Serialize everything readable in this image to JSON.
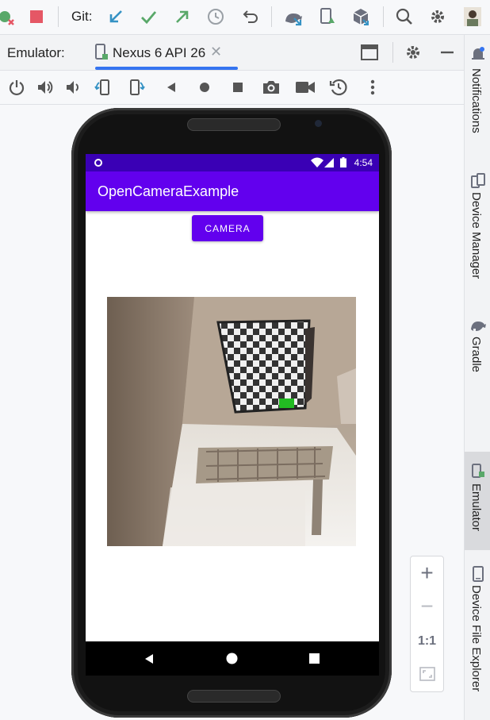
{
  "toolbar": {
    "git_label": "Git:",
    "icons": [
      "debug-stop-icon",
      "stop-icon",
      "update-project-icon",
      "commit-icon",
      "push-icon",
      "history-icon",
      "rollback-icon",
      "device-manager-icon",
      "app-inspection-icon",
      "sdk-icon",
      "search-icon",
      "settings-icon",
      "avatar-icon"
    ]
  },
  "emulator_header": {
    "label": "Emulator:",
    "tab_name": "Nexus 6 API 26",
    "tab_close": "✕"
  },
  "right_sidebar": {
    "items": [
      {
        "label": "Notifications",
        "icon": "bell-icon"
      },
      {
        "label": "Device Manager",
        "icon": "device-manager-icon"
      },
      {
        "label": "Gradle",
        "icon": "elephant-icon"
      },
      {
        "label": "Emulator",
        "icon": "emulator-icon",
        "active": true
      },
      {
        "label": "Device File Explorer",
        "icon": "phone-icon"
      }
    ]
  },
  "phone": {
    "status_time": "4:54",
    "app_title": "OpenCameraExample",
    "camera_button": "CAMERA"
  },
  "zoom": {
    "zoom_in": "+",
    "zoom_out": "−",
    "actual_size": "1:1"
  },
  "colors": {
    "accent": "#3574f0",
    "app_bar": "#6200ee",
    "status_bar": "#3a00b5",
    "stop_red": "#e55765",
    "git_blue": "#3592c4",
    "git_green": "#59a869"
  }
}
